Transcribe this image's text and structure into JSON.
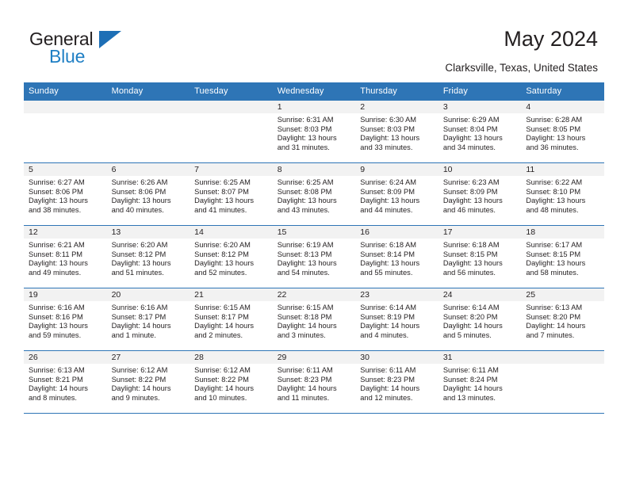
{
  "brand": {
    "name_part1": "General",
    "name_part2": "Blue",
    "flag_icon": "triangle-flag-icon"
  },
  "header": {
    "title": "May 2024",
    "location": "Clarksville, Texas, United States"
  },
  "weekday_headers": [
    "Sunday",
    "Monday",
    "Tuesday",
    "Wednesday",
    "Thursday",
    "Friday",
    "Saturday"
  ],
  "colors": {
    "header_blue": "#2e75b6",
    "logo_blue": "#1f7fc4",
    "day_band_gray": "#f2f2f2",
    "text": "#231f20"
  },
  "labels": {
    "sunrise_prefix": "Sunrise:",
    "sunset_prefix": "Sunset:",
    "daylight_prefix": "Daylight:"
  },
  "weeks": [
    [
      {
        "day": "",
        "sunrise": "",
        "sunset": "",
        "daylight_line1": "",
        "daylight_line2": "",
        "empty": true
      },
      {
        "day": "",
        "sunrise": "",
        "sunset": "",
        "daylight_line1": "",
        "daylight_line2": "",
        "empty": true
      },
      {
        "day": "",
        "sunrise": "",
        "sunset": "",
        "daylight_line1": "",
        "daylight_line2": "",
        "empty": true
      },
      {
        "day": "1",
        "sunrise": "Sunrise: 6:31 AM",
        "sunset": "Sunset: 8:03 PM",
        "daylight_line1": "Daylight: 13 hours",
        "daylight_line2": "and 31 minutes.",
        "empty": false
      },
      {
        "day": "2",
        "sunrise": "Sunrise: 6:30 AM",
        "sunset": "Sunset: 8:03 PM",
        "daylight_line1": "Daylight: 13 hours",
        "daylight_line2": "and 33 minutes.",
        "empty": false
      },
      {
        "day": "3",
        "sunrise": "Sunrise: 6:29 AM",
        "sunset": "Sunset: 8:04 PM",
        "daylight_line1": "Daylight: 13 hours",
        "daylight_line2": "and 34 minutes.",
        "empty": false
      },
      {
        "day": "4",
        "sunrise": "Sunrise: 6:28 AM",
        "sunset": "Sunset: 8:05 PM",
        "daylight_line1": "Daylight: 13 hours",
        "daylight_line2": "and 36 minutes.",
        "empty": false
      }
    ],
    [
      {
        "day": "5",
        "sunrise": "Sunrise: 6:27 AM",
        "sunset": "Sunset: 8:06 PM",
        "daylight_line1": "Daylight: 13 hours",
        "daylight_line2": "and 38 minutes.",
        "empty": false
      },
      {
        "day": "6",
        "sunrise": "Sunrise: 6:26 AM",
        "sunset": "Sunset: 8:06 PM",
        "daylight_line1": "Daylight: 13 hours",
        "daylight_line2": "and 40 minutes.",
        "empty": false
      },
      {
        "day": "7",
        "sunrise": "Sunrise: 6:25 AM",
        "sunset": "Sunset: 8:07 PM",
        "daylight_line1": "Daylight: 13 hours",
        "daylight_line2": "and 41 minutes.",
        "empty": false
      },
      {
        "day": "8",
        "sunrise": "Sunrise: 6:25 AM",
        "sunset": "Sunset: 8:08 PM",
        "daylight_line1": "Daylight: 13 hours",
        "daylight_line2": "and 43 minutes.",
        "empty": false
      },
      {
        "day": "9",
        "sunrise": "Sunrise: 6:24 AM",
        "sunset": "Sunset: 8:09 PM",
        "daylight_line1": "Daylight: 13 hours",
        "daylight_line2": "and 44 minutes.",
        "empty": false
      },
      {
        "day": "10",
        "sunrise": "Sunrise: 6:23 AM",
        "sunset": "Sunset: 8:09 PM",
        "daylight_line1": "Daylight: 13 hours",
        "daylight_line2": "and 46 minutes.",
        "empty": false
      },
      {
        "day": "11",
        "sunrise": "Sunrise: 6:22 AM",
        "sunset": "Sunset: 8:10 PM",
        "daylight_line1": "Daylight: 13 hours",
        "daylight_line2": "and 48 minutes.",
        "empty": false
      }
    ],
    [
      {
        "day": "12",
        "sunrise": "Sunrise: 6:21 AM",
        "sunset": "Sunset: 8:11 PM",
        "daylight_line1": "Daylight: 13 hours",
        "daylight_line2": "and 49 minutes.",
        "empty": false
      },
      {
        "day": "13",
        "sunrise": "Sunrise: 6:20 AM",
        "sunset": "Sunset: 8:12 PM",
        "daylight_line1": "Daylight: 13 hours",
        "daylight_line2": "and 51 minutes.",
        "empty": false
      },
      {
        "day": "14",
        "sunrise": "Sunrise: 6:20 AM",
        "sunset": "Sunset: 8:12 PM",
        "daylight_line1": "Daylight: 13 hours",
        "daylight_line2": "and 52 minutes.",
        "empty": false
      },
      {
        "day": "15",
        "sunrise": "Sunrise: 6:19 AM",
        "sunset": "Sunset: 8:13 PM",
        "daylight_line1": "Daylight: 13 hours",
        "daylight_line2": "and 54 minutes.",
        "empty": false
      },
      {
        "day": "16",
        "sunrise": "Sunrise: 6:18 AM",
        "sunset": "Sunset: 8:14 PM",
        "daylight_line1": "Daylight: 13 hours",
        "daylight_line2": "and 55 minutes.",
        "empty": false
      },
      {
        "day": "17",
        "sunrise": "Sunrise: 6:18 AM",
        "sunset": "Sunset: 8:15 PM",
        "daylight_line1": "Daylight: 13 hours",
        "daylight_line2": "and 56 minutes.",
        "empty": false
      },
      {
        "day": "18",
        "sunrise": "Sunrise: 6:17 AM",
        "sunset": "Sunset: 8:15 PM",
        "daylight_line1": "Daylight: 13 hours",
        "daylight_line2": "and 58 minutes.",
        "empty": false
      }
    ],
    [
      {
        "day": "19",
        "sunrise": "Sunrise: 6:16 AM",
        "sunset": "Sunset: 8:16 PM",
        "daylight_line1": "Daylight: 13 hours",
        "daylight_line2": "and 59 minutes.",
        "empty": false
      },
      {
        "day": "20",
        "sunrise": "Sunrise: 6:16 AM",
        "sunset": "Sunset: 8:17 PM",
        "daylight_line1": "Daylight: 14 hours",
        "daylight_line2": "and 1 minute.",
        "empty": false
      },
      {
        "day": "21",
        "sunrise": "Sunrise: 6:15 AM",
        "sunset": "Sunset: 8:17 PM",
        "daylight_line1": "Daylight: 14 hours",
        "daylight_line2": "and 2 minutes.",
        "empty": false
      },
      {
        "day": "22",
        "sunrise": "Sunrise: 6:15 AM",
        "sunset": "Sunset: 8:18 PM",
        "daylight_line1": "Daylight: 14 hours",
        "daylight_line2": "and 3 minutes.",
        "empty": false
      },
      {
        "day": "23",
        "sunrise": "Sunrise: 6:14 AM",
        "sunset": "Sunset: 8:19 PM",
        "daylight_line1": "Daylight: 14 hours",
        "daylight_line2": "and 4 minutes.",
        "empty": false
      },
      {
        "day": "24",
        "sunrise": "Sunrise: 6:14 AM",
        "sunset": "Sunset: 8:20 PM",
        "daylight_line1": "Daylight: 14 hours",
        "daylight_line2": "and 5 minutes.",
        "empty": false
      },
      {
        "day": "25",
        "sunrise": "Sunrise: 6:13 AM",
        "sunset": "Sunset: 8:20 PM",
        "daylight_line1": "Daylight: 14 hours",
        "daylight_line2": "and 7 minutes.",
        "empty": false
      }
    ],
    [
      {
        "day": "26",
        "sunrise": "Sunrise: 6:13 AM",
        "sunset": "Sunset: 8:21 PM",
        "daylight_line1": "Daylight: 14 hours",
        "daylight_line2": "and 8 minutes.",
        "empty": false
      },
      {
        "day": "27",
        "sunrise": "Sunrise: 6:12 AM",
        "sunset": "Sunset: 8:22 PM",
        "daylight_line1": "Daylight: 14 hours",
        "daylight_line2": "and 9 minutes.",
        "empty": false
      },
      {
        "day": "28",
        "sunrise": "Sunrise: 6:12 AM",
        "sunset": "Sunset: 8:22 PM",
        "daylight_line1": "Daylight: 14 hours",
        "daylight_line2": "and 10 minutes.",
        "empty": false
      },
      {
        "day": "29",
        "sunrise": "Sunrise: 6:11 AM",
        "sunset": "Sunset: 8:23 PM",
        "daylight_line1": "Daylight: 14 hours",
        "daylight_line2": "and 11 minutes.",
        "empty": false
      },
      {
        "day": "30",
        "sunrise": "Sunrise: 6:11 AM",
        "sunset": "Sunset: 8:23 PM",
        "daylight_line1": "Daylight: 14 hours",
        "daylight_line2": "and 12 minutes.",
        "empty": false
      },
      {
        "day": "31",
        "sunrise": "Sunrise: 6:11 AM",
        "sunset": "Sunset: 8:24 PM",
        "daylight_line1": "Daylight: 14 hours",
        "daylight_line2": "and 13 minutes.",
        "empty": false
      },
      {
        "day": "",
        "sunrise": "",
        "sunset": "",
        "daylight_line1": "",
        "daylight_line2": "",
        "empty": true
      }
    ]
  ]
}
